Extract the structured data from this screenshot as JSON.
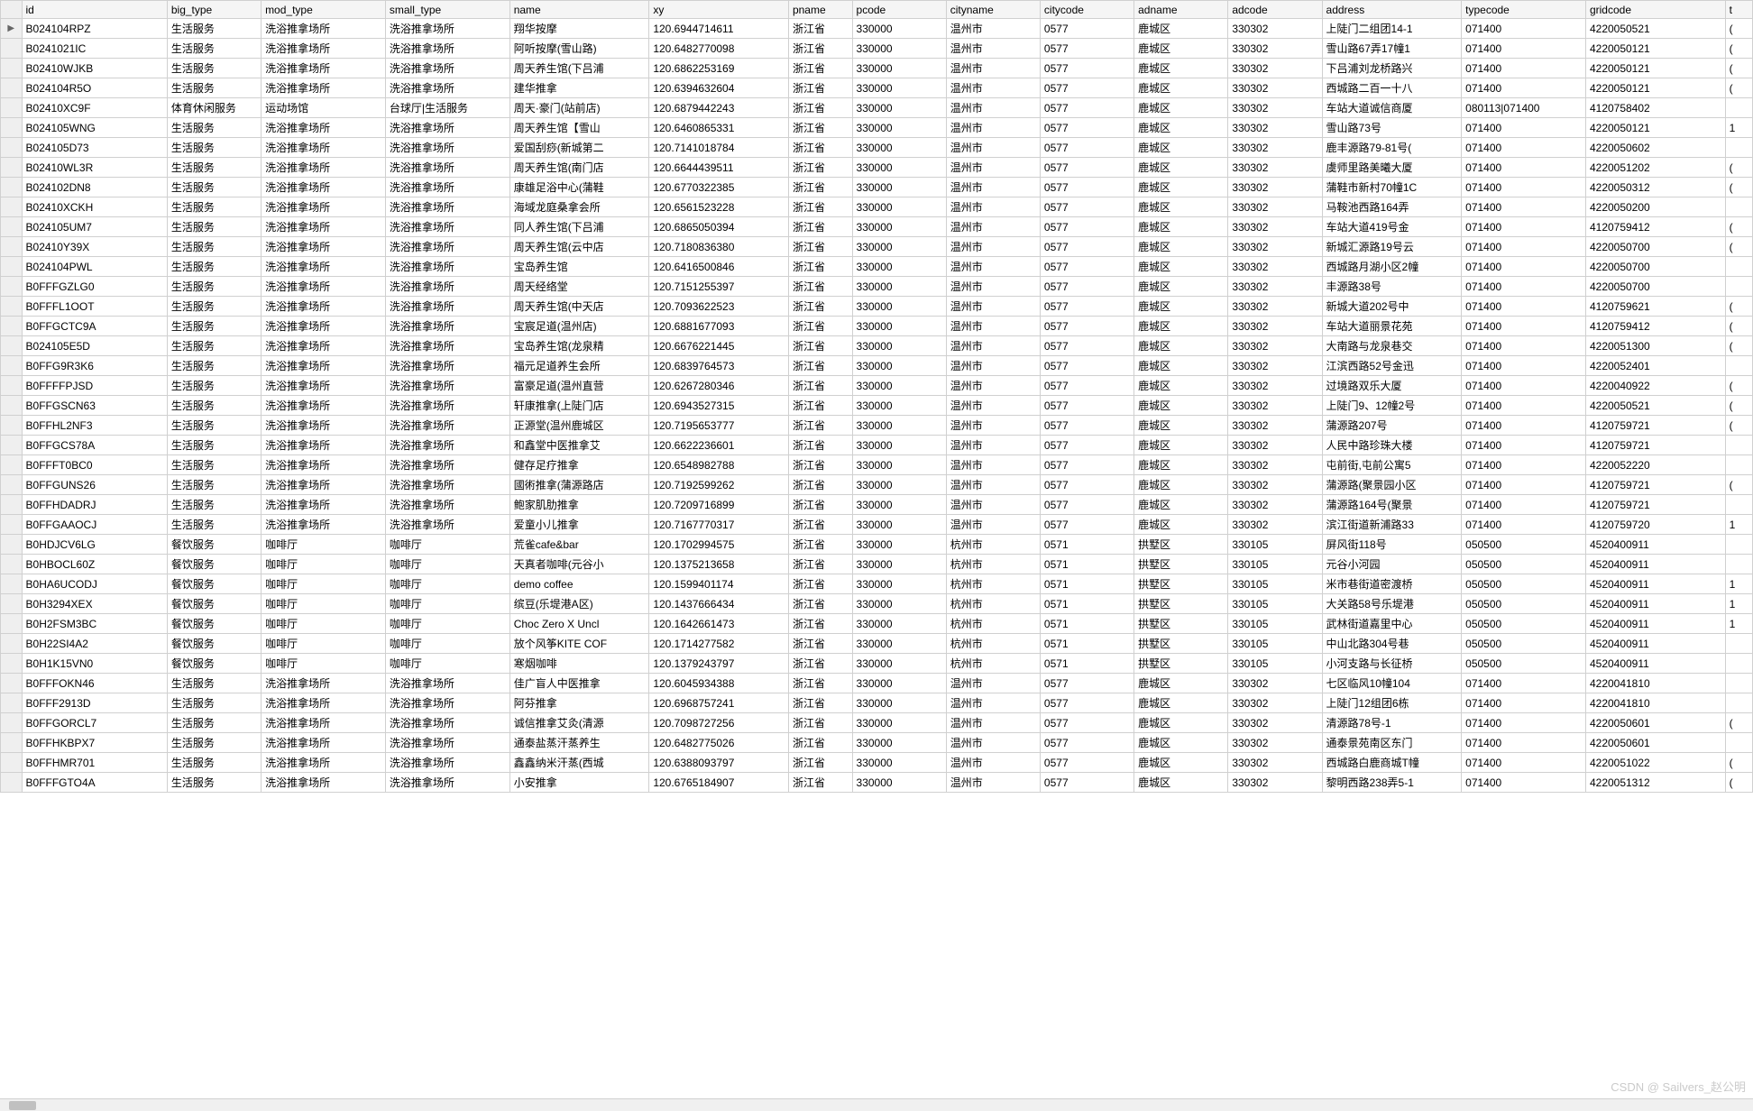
{
  "watermark": "CSDN @ Sailvers_赵公明",
  "columns": [
    "id",
    "big_type",
    "mod_type",
    "small_type",
    "name",
    "xy",
    "pname",
    "pcode",
    "cityname",
    "citycode",
    "adname",
    "adcode",
    "address",
    "typecode",
    "gridcode",
    "t"
  ],
  "rows": [
    {
      "ind": "▶",
      "id": "B024104RPZ",
      "big_type": "生活服务",
      "mod_type": "洗浴推拿场所",
      "small_type": "洗浴推拿场所",
      "name": "翔华按摩",
      "xy": "120.6944714611",
      "pname": "浙江省",
      "pcode": "330000",
      "cityname": "温州市",
      "citycode": "0577",
      "adname": "鹿城区",
      "adcode": "330302",
      "address": "上陡门二组团14-1",
      "typecode": "071400",
      "gridcode": "4220050521",
      "t": "("
    },
    {
      "ind": "",
      "id": "B0241021IC",
      "big_type": "生活服务",
      "mod_type": "洗浴推拿场所",
      "small_type": "洗浴推拿场所",
      "name": "阿听按摩(雪山路)",
      "xy": "120.6482770098",
      "pname": "浙江省",
      "pcode": "330000",
      "cityname": "温州市",
      "citycode": "0577",
      "adname": "鹿城区",
      "adcode": "330302",
      "address": "雪山路67弄17幢1",
      "typecode": "071400",
      "gridcode": "4220050121",
      "t": "("
    },
    {
      "ind": "",
      "id": "B02410WJKB",
      "big_type": "生活服务",
      "mod_type": "洗浴推拿场所",
      "small_type": "洗浴推拿场所",
      "name": "周天养生馆(下吕浦",
      "xy": "120.6862253169",
      "pname": "浙江省",
      "pcode": "330000",
      "cityname": "温州市",
      "citycode": "0577",
      "adname": "鹿城区",
      "adcode": "330302",
      "address": "下吕浦刘龙桥路兴",
      "typecode": "071400",
      "gridcode": "4220050121",
      "t": "("
    },
    {
      "ind": "",
      "id": "B024104R5O",
      "big_type": "生活服务",
      "mod_type": "洗浴推拿场所",
      "small_type": "洗浴推拿场所",
      "name": "建华推拿",
      "xy": "120.6394632604",
      "pname": "浙江省",
      "pcode": "330000",
      "cityname": "温州市",
      "citycode": "0577",
      "adname": "鹿城区",
      "adcode": "330302",
      "address": "西城路二百一十八",
      "typecode": "071400",
      "gridcode": "4220050121",
      "t": "("
    },
    {
      "ind": "",
      "id": "B02410XC9F",
      "big_type": "体育休闲服务",
      "mod_type": "运动场馆",
      "small_type": "台球厅|生活服务",
      "name": "周天·豪门(站前店)",
      "xy": "120.6879442243",
      "pname": "浙江省",
      "pcode": "330000",
      "cityname": "温州市",
      "citycode": "0577",
      "adname": "鹿城区",
      "adcode": "330302",
      "address": "车站大道诚信商厦",
      "typecode": "080113|071400",
      "gridcode": "4120758402",
      "t": ""
    },
    {
      "ind": "",
      "id": "B024105WNG",
      "big_type": "生活服务",
      "mod_type": "洗浴推拿场所",
      "small_type": "洗浴推拿场所",
      "name": "周天养生馆【雪山",
      "xy": "120.6460865331",
      "pname": "浙江省",
      "pcode": "330000",
      "cityname": "温州市",
      "citycode": "0577",
      "adname": "鹿城区",
      "adcode": "330302",
      "address": "雪山路73号",
      "typecode": "071400",
      "gridcode": "4220050121",
      "t": "1"
    },
    {
      "ind": "",
      "id": "B024105D73",
      "big_type": "生活服务",
      "mod_type": "洗浴推拿场所",
      "small_type": "洗浴推拿场所",
      "name": "爱国刮痧(新城第二",
      "xy": "120.7141018784",
      "pname": "浙江省",
      "pcode": "330000",
      "cityname": "温州市",
      "citycode": "0577",
      "adname": "鹿城区",
      "adcode": "330302",
      "address": "鹿丰源路79-81号(",
      "typecode": "071400",
      "gridcode": "4220050602",
      "t": ""
    },
    {
      "ind": "",
      "id": "B02410WL3R",
      "big_type": "生活服务",
      "mod_type": "洗浴推拿场所",
      "small_type": "洗浴推拿场所",
      "name": "周天养生馆(南门店",
      "xy": "120.6644439511",
      "pname": "浙江省",
      "pcode": "330000",
      "cityname": "温州市",
      "citycode": "0577",
      "adname": "鹿城区",
      "adcode": "330302",
      "address": "虞师里路美曦大厦",
      "typecode": "071400",
      "gridcode": "4220051202",
      "t": "("
    },
    {
      "ind": "",
      "id": "B024102DN8",
      "big_type": "生活服务",
      "mod_type": "洗浴推拿场所",
      "small_type": "洗浴推拿场所",
      "name": "康雄足浴中心(蒲鞋",
      "xy": "120.6770322385",
      "pname": "浙江省",
      "pcode": "330000",
      "cityname": "温州市",
      "citycode": "0577",
      "adname": "鹿城区",
      "adcode": "330302",
      "address": "蒲鞋市新村70幢1C",
      "typecode": "071400",
      "gridcode": "4220050312",
      "t": "("
    },
    {
      "ind": "",
      "id": "B02410XCKH",
      "big_type": "生活服务",
      "mod_type": "洗浴推拿场所",
      "small_type": "洗浴推拿场所",
      "name": "海域龙庭桑拿会所",
      "xy": "120.6561523228",
      "pname": "浙江省",
      "pcode": "330000",
      "cityname": "温州市",
      "citycode": "0577",
      "adname": "鹿城区",
      "adcode": "330302",
      "address": "马鞍池西路164弄",
      "typecode": "071400",
      "gridcode": "4220050200",
      "t": ""
    },
    {
      "ind": "",
      "id": "B024105UM7",
      "big_type": "生活服务",
      "mod_type": "洗浴推拿场所",
      "small_type": "洗浴推拿场所",
      "name": "同人养生馆(下吕浦",
      "xy": "120.6865050394",
      "pname": "浙江省",
      "pcode": "330000",
      "cityname": "温州市",
      "citycode": "0577",
      "adname": "鹿城区",
      "adcode": "330302",
      "address": "车站大道419号金",
      "typecode": "071400",
      "gridcode": "4120759412",
      "t": "("
    },
    {
      "ind": "",
      "id": "B02410Y39X",
      "big_type": "生活服务",
      "mod_type": "洗浴推拿场所",
      "small_type": "洗浴推拿场所",
      "name": "周天养生馆(云中店",
      "xy": "120.7180836380",
      "pname": "浙江省",
      "pcode": "330000",
      "cityname": "温州市",
      "citycode": "0577",
      "adname": "鹿城区",
      "adcode": "330302",
      "address": "新城汇源路19号云",
      "typecode": "071400",
      "gridcode": "4220050700",
      "t": "("
    },
    {
      "ind": "",
      "id": "B024104PWL",
      "big_type": "生活服务",
      "mod_type": "洗浴推拿场所",
      "small_type": "洗浴推拿场所",
      "name": "宝岛养生馆",
      "xy": "120.6416500846",
      "pname": "浙江省",
      "pcode": "330000",
      "cityname": "温州市",
      "citycode": "0577",
      "adname": "鹿城区",
      "adcode": "330302",
      "address": "西城路月湖小区2幢",
      "typecode": "071400",
      "gridcode": "4220050700",
      "t": ""
    },
    {
      "ind": "",
      "id": "B0FFFGZLG0",
      "big_type": "生活服务",
      "mod_type": "洗浴推拿场所",
      "small_type": "洗浴推拿场所",
      "name": "周天经络堂",
      "xy": "120.7151255397",
      "pname": "浙江省",
      "pcode": "330000",
      "cityname": "温州市",
      "citycode": "0577",
      "adname": "鹿城区",
      "adcode": "330302",
      "address": "丰源路38号",
      "typecode": "071400",
      "gridcode": "4220050700",
      "t": ""
    },
    {
      "ind": "",
      "id": "B0FFFL1OOT",
      "big_type": "生活服务",
      "mod_type": "洗浴推拿场所",
      "small_type": "洗浴推拿场所",
      "name": "周天养生馆(中天店",
      "xy": "120.7093622523",
      "pname": "浙江省",
      "pcode": "330000",
      "cityname": "温州市",
      "citycode": "0577",
      "adname": "鹿城区",
      "adcode": "330302",
      "address": "新城大道202号中",
      "typecode": "071400",
      "gridcode": "4120759621",
      "t": "("
    },
    {
      "ind": "",
      "id": "B0FFGCTC9A",
      "big_type": "生活服务",
      "mod_type": "洗浴推拿场所",
      "small_type": "洗浴推拿场所",
      "name": "宝宸足道(温州店)",
      "xy": "120.6881677093",
      "pname": "浙江省",
      "pcode": "330000",
      "cityname": "温州市",
      "citycode": "0577",
      "adname": "鹿城区",
      "adcode": "330302",
      "address": "车站大道丽景花苑",
      "typecode": "071400",
      "gridcode": "4120759412",
      "t": "("
    },
    {
      "ind": "",
      "id": "B024105E5D",
      "big_type": "生活服务",
      "mod_type": "洗浴推拿场所",
      "small_type": "洗浴推拿场所",
      "name": "宝岛养生馆(龙泉精",
      "xy": "120.6676221445",
      "pname": "浙江省",
      "pcode": "330000",
      "cityname": "温州市",
      "citycode": "0577",
      "adname": "鹿城区",
      "adcode": "330302",
      "address": "大南路与龙泉巷交",
      "typecode": "071400",
      "gridcode": "4220051300",
      "t": "("
    },
    {
      "ind": "",
      "id": "B0FFG9R3K6",
      "big_type": "生活服务",
      "mod_type": "洗浴推拿场所",
      "small_type": "洗浴推拿场所",
      "name": "福元足道养生会所",
      "xy": "120.6839764573",
      "pname": "浙江省",
      "pcode": "330000",
      "cityname": "温州市",
      "citycode": "0577",
      "adname": "鹿城区",
      "adcode": "330302",
      "address": "江滨西路52号金迅",
      "typecode": "071400",
      "gridcode": "4220052401",
      "t": ""
    },
    {
      "ind": "",
      "id": "B0FFFFPJSD",
      "big_type": "生活服务",
      "mod_type": "洗浴推拿场所",
      "small_type": "洗浴推拿场所",
      "name": "富豪足道(温州直营",
      "xy": "120.6267280346",
      "pname": "浙江省",
      "pcode": "330000",
      "cityname": "温州市",
      "citycode": "0577",
      "adname": "鹿城区",
      "adcode": "330302",
      "address": "过境路双乐大厦",
      "typecode": "071400",
      "gridcode": "4220040922",
      "t": "("
    },
    {
      "ind": "",
      "id": "B0FFGSCN63",
      "big_type": "生活服务",
      "mod_type": "洗浴推拿场所",
      "small_type": "洗浴推拿场所",
      "name": "轩康推拿(上陡门店",
      "xy": "120.6943527315",
      "pname": "浙江省",
      "pcode": "330000",
      "cityname": "温州市",
      "citycode": "0577",
      "adname": "鹿城区",
      "adcode": "330302",
      "address": "上陡门9、12幢2号",
      "typecode": "071400",
      "gridcode": "4220050521",
      "t": "("
    },
    {
      "ind": "",
      "id": "B0FFHL2NF3",
      "big_type": "生活服务",
      "mod_type": "洗浴推拿场所",
      "small_type": "洗浴推拿场所",
      "name": "正源堂(温州鹿城区",
      "xy": "120.7195653777",
      "pname": "浙江省",
      "pcode": "330000",
      "cityname": "温州市",
      "citycode": "0577",
      "adname": "鹿城区",
      "adcode": "330302",
      "address": "蒲源路207号",
      "typecode": "071400",
      "gridcode": "4120759721",
      "t": "("
    },
    {
      "ind": "",
      "id": "B0FFGCS78A",
      "big_type": "生活服务",
      "mod_type": "洗浴推拿场所",
      "small_type": "洗浴推拿场所",
      "name": "和鑫堂中医推拿艾",
      "xy": "120.6622236601",
      "pname": "浙江省",
      "pcode": "330000",
      "cityname": "温州市",
      "citycode": "0577",
      "adname": "鹿城区",
      "adcode": "330302",
      "address": "人民中路珍珠大楼",
      "typecode": "071400",
      "gridcode": "4120759721",
      "t": ""
    },
    {
      "ind": "",
      "id": "B0FFFT0BC0",
      "big_type": "生活服务",
      "mod_type": "洗浴推拿场所",
      "small_type": "洗浴推拿场所",
      "name": "健存足疗推拿",
      "xy": "120.6548982788",
      "pname": "浙江省",
      "pcode": "330000",
      "cityname": "温州市",
      "citycode": "0577",
      "adname": "鹿城区",
      "adcode": "330302",
      "address": "屯前街,屯前公寓5",
      "typecode": "071400",
      "gridcode": "4220052220",
      "t": ""
    },
    {
      "ind": "",
      "id": "B0FFGUNS26",
      "big_type": "生活服务",
      "mod_type": "洗浴推拿场所",
      "small_type": "洗浴推拿场所",
      "name": "國術推拿(蒲源路店",
      "xy": "120.7192599262",
      "pname": "浙江省",
      "pcode": "330000",
      "cityname": "温州市",
      "citycode": "0577",
      "adname": "鹿城区",
      "adcode": "330302",
      "address": "蒲源路(聚景园小区",
      "typecode": "071400",
      "gridcode": "4120759721",
      "t": "("
    },
    {
      "ind": "",
      "id": "B0FFHDADRJ",
      "big_type": "生活服务",
      "mod_type": "洗浴推拿场所",
      "small_type": "洗浴推拿场所",
      "name": "鲍家肌肋推拿",
      "xy": "120.7209716899",
      "pname": "浙江省",
      "pcode": "330000",
      "cityname": "温州市",
      "citycode": "0577",
      "adname": "鹿城区",
      "adcode": "330302",
      "address": "蒲源路164号(聚景",
      "typecode": "071400",
      "gridcode": "4120759721",
      "t": ""
    },
    {
      "ind": "",
      "id": "B0FFGAAOCJ",
      "big_type": "生活服务",
      "mod_type": "洗浴推拿场所",
      "small_type": "洗浴推拿场所",
      "name": "爱童小儿推拿",
      "xy": "120.7167770317",
      "pname": "浙江省",
      "pcode": "330000",
      "cityname": "温州市",
      "citycode": "0577",
      "adname": "鹿城区",
      "adcode": "330302",
      "address": "滨江街道新浦路33",
      "typecode": "071400",
      "gridcode": "4120759720",
      "t": "1"
    },
    {
      "ind": "",
      "id": "B0HDJCV6LG",
      "big_type": "餐饮服务",
      "mod_type": "咖啡厅",
      "small_type": "咖啡厅",
      "name": "荒雀cafe&bar",
      "xy": "120.1702994575",
      "pname": "浙江省",
      "pcode": "330000",
      "cityname": "杭州市",
      "citycode": "0571",
      "adname": "拱墅区",
      "adcode": "330105",
      "address": "屏风街118号",
      "typecode": "050500",
      "gridcode": "4520400911",
      "t": ""
    },
    {
      "ind": "",
      "id": "B0HBOCL60Z",
      "big_type": "餐饮服务",
      "mod_type": "咖啡厅",
      "small_type": "咖啡厅",
      "name": "天真者咖啡(元谷小",
      "xy": "120.1375213658",
      "pname": "浙江省",
      "pcode": "330000",
      "cityname": "杭州市",
      "citycode": "0571",
      "adname": "拱墅区",
      "adcode": "330105",
      "address": "元谷小河园",
      "typecode": "050500",
      "gridcode": "4520400911",
      "t": ""
    },
    {
      "ind": "",
      "id": "B0HA6UCODJ",
      "big_type": "餐饮服务",
      "mod_type": "咖啡厅",
      "small_type": "咖啡厅",
      "name": "demo coffee",
      "xy": "120.1599401174",
      "pname": "浙江省",
      "pcode": "330000",
      "cityname": "杭州市",
      "citycode": "0571",
      "adname": "拱墅区",
      "adcode": "330105",
      "address": "米市巷街道密渡桥",
      "typecode": "050500",
      "gridcode": "4520400911",
      "t": "1"
    },
    {
      "ind": "",
      "id": "B0H3294XEX",
      "big_type": "餐饮服务",
      "mod_type": "咖啡厅",
      "small_type": "咖啡厅",
      "name": "缤豆(乐堤港A区)",
      "xy": "120.1437666434",
      "pname": "浙江省",
      "pcode": "330000",
      "cityname": "杭州市",
      "citycode": "0571",
      "adname": "拱墅区",
      "adcode": "330105",
      "address": "大关路58号乐堤港",
      "typecode": "050500",
      "gridcode": "4520400911",
      "t": "1"
    },
    {
      "ind": "",
      "id": "B0H2FSM3BC",
      "big_type": "餐饮服务",
      "mod_type": "咖啡厅",
      "small_type": "咖啡厅",
      "name": "Choc Zero X Uncl",
      "xy": "120.1642661473",
      "pname": "浙江省",
      "pcode": "330000",
      "cityname": "杭州市",
      "citycode": "0571",
      "adname": "拱墅区",
      "adcode": "330105",
      "address": "武林街道嘉里中心",
      "typecode": "050500",
      "gridcode": "4520400911",
      "t": "1"
    },
    {
      "ind": "",
      "id": "B0H22SI4A2",
      "big_type": "餐饮服务",
      "mod_type": "咖啡厅",
      "small_type": "咖啡厅",
      "name": "放个风筝KITE COF",
      "xy": "120.1714277582",
      "pname": "浙江省",
      "pcode": "330000",
      "cityname": "杭州市",
      "citycode": "0571",
      "adname": "拱墅区",
      "adcode": "330105",
      "address": "中山北路304号巷",
      "typecode": "050500",
      "gridcode": "4520400911",
      "t": ""
    },
    {
      "ind": "",
      "id": "B0H1K15VN0",
      "big_type": "餐饮服务",
      "mod_type": "咖啡厅",
      "small_type": "咖啡厅",
      "name": "寒烟咖啡",
      "xy": "120.1379243797",
      "pname": "浙江省",
      "pcode": "330000",
      "cityname": "杭州市",
      "citycode": "0571",
      "adname": "拱墅区",
      "adcode": "330105",
      "address": "小河支路与长征桥",
      "typecode": "050500",
      "gridcode": "4520400911",
      "t": ""
    },
    {
      "ind": "",
      "id": "B0FFFOKN46",
      "big_type": "生活服务",
      "mod_type": "洗浴推拿场所",
      "small_type": "洗浴推拿场所",
      "name": "佳广盲人中医推拿",
      "xy": "120.6045934388",
      "pname": "浙江省",
      "pcode": "330000",
      "cityname": "温州市",
      "citycode": "0577",
      "adname": "鹿城区",
      "adcode": "330302",
      "address": "七区临风10幢104",
      "typecode": "071400",
      "gridcode": "4220041810",
      "t": ""
    },
    {
      "ind": "",
      "id": "B0FFF2913D",
      "big_type": "生活服务",
      "mod_type": "洗浴推拿场所",
      "small_type": "洗浴推拿场所",
      "name": "阿芬推拿",
      "xy": "120.6968757241",
      "pname": "浙江省",
      "pcode": "330000",
      "cityname": "温州市",
      "citycode": "0577",
      "adname": "鹿城区",
      "adcode": "330302",
      "address": "上陡门12组团6栋",
      "typecode": "071400",
      "gridcode": "4220041810",
      "t": ""
    },
    {
      "ind": "",
      "id": "B0FFGORCL7",
      "big_type": "生活服务",
      "mod_type": "洗浴推拿场所",
      "small_type": "洗浴推拿场所",
      "name": "诚信推拿艾灸(清源",
      "xy": "120.7098727256",
      "pname": "浙江省",
      "pcode": "330000",
      "cityname": "温州市",
      "citycode": "0577",
      "adname": "鹿城区",
      "adcode": "330302",
      "address": "清源路78号-1",
      "typecode": "071400",
      "gridcode": "4220050601",
      "t": "("
    },
    {
      "ind": "",
      "id": "B0FFHKBPX7",
      "big_type": "生活服务",
      "mod_type": "洗浴推拿场所",
      "small_type": "洗浴推拿场所",
      "name": "通泰盐蒸汗蒸养生",
      "xy": "120.6482775026",
      "pname": "浙江省",
      "pcode": "330000",
      "cityname": "温州市",
      "citycode": "0577",
      "adname": "鹿城区",
      "adcode": "330302",
      "address": "通泰景苑南区东门",
      "typecode": "071400",
      "gridcode": "4220050601",
      "t": ""
    },
    {
      "ind": "",
      "id": "B0FFHMR701",
      "big_type": "生活服务",
      "mod_type": "洗浴推拿场所",
      "small_type": "洗浴推拿场所",
      "name": "鑫鑫纳米汗蒸(西城",
      "xy": "120.6388093797",
      "pname": "浙江省",
      "pcode": "330000",
      "cityname": "温州市",
      "citycode": "0577",
      "adname": "鹿城区",
      "adcode": "330302",
      "address": "西城路白鹿商城T幢",
      "typecode": "071400",
      "gridcode": "4220051022",
      "t": "("
    },
    {
      "ind": "",
      "id": "B0FFFGTO4A",
      "big_type": "生活服务",
      "mod_type": "洗浴推拿场所",
      "small_type": "洗浴推拿场所",
      "name": "小安推拿",
      "xy": "120.6765184907",
      "pname": "浙江省",
      "pcode": "330000",
      "cityname": "温州市",
      "citycode": "0577",
      "adname": "鹿城区",
      "adcode": "330302",
      "address": "黎明西路238弄5-1",
      "typecode": "071400",
      "gridcode": "4220051312",
      "t": "("
    }
  ]
}
